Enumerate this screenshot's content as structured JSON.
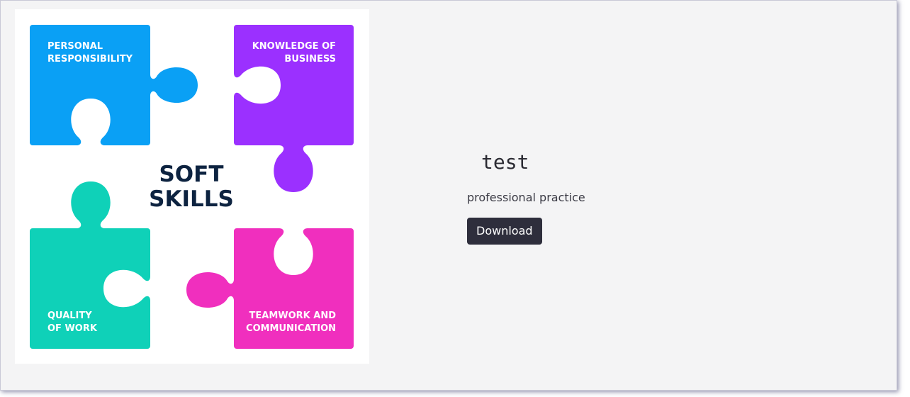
{
  "image": {
    "alt": "soft skills puzzle illustration",
    "center_line1": "SOFT",
    "center_line2": "SKILLS",
    "pieces": {
      "top_left": {
        "line1": "PERSONAL",
        "line2": "RESPONSIBILITY",
        "color": "#0aa0f5"
      },
      "top_right": {
        "line1": "KNOWLEDGE OF",
        "line2": "BUSINESS",
        "color": "#9b30ff"
      },
      "bottom_left": {
        "line1": "QUALITY",
        "line2": "OF WORK",
        "color": "#0fd1b8"
      },
      "bottom_right": {
        "line1": "TEAMWORK AND",
        "line2": "COMMUNICATION",
        "color": "#f02fbe"
      }
    }
  },
  "item": {
    "title": "test",
    "description": "professional practice",
    "download_label": "Download"
  },
  "colors": {
    "card_background": "#f4f4f5",
    "button_background": "#2e2e3c",
    "center_text": "#0d2340"
  }
}
